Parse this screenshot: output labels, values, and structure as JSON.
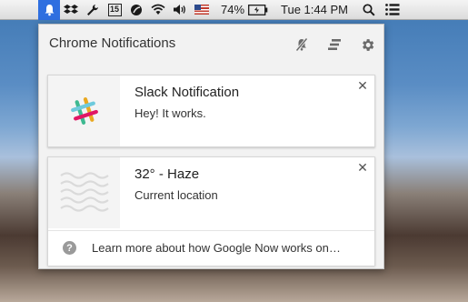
{
  "menubar": {
    "items": [
      {
        "name": "notification-bell-icon"
      },
      {
        "name": "dropbox-icon"
      },
      {
        "name": "wrench-icon"
      },
      {
        "name": "calendar-icon",
        "text": "15"
      },
      {
        "name": "leaf-icon"
      },
      {
        "name": "wifi-icon"
      },
      {
        "name": "volume-icon"
      },
      {
        "name": "us-flag-icon"
      }
    ],
    "battery_percent": "74%",
    "clock": "Tue 1:44 PM"
  },
  "panel": {
    "title": "Chrome Notifications",
    "header_icons": [
      "mute-bell-icon",
      "clear-all-icon",
      "gear-icon"
    ],
    "notifications": [
      {
        "title": "Slack Notification",
        "message": "Hey! It works.",
        "icon": "slack-logo-icon"
      },
      {
        "title": "32° - Haze",
        "message": "Current location",
        "icon": "haze-weather-icon",
        "footer": "Learn more about how Google Now works on…"
      }
    ]
  }
}
